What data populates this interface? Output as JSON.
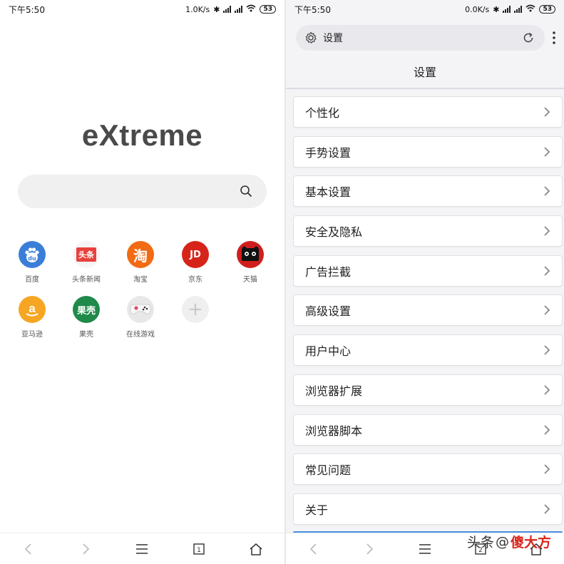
{
  "left": {
    "status": {
      "time": "下午5:50",
      "speed": "1.0K/s",
      "battery": "53"
    },
    "logo": "eXtreme",
    "shortcuts": [
      {
        "label": "百度",
        "icon": "baidu-icon",
        "glyph": "du",
        "color": "#3b7ed8"
      },
      {
        "label": "头条新闻",
        "icon": "toutiao-icon",
        "glyph": "头条",
        "color": "#e8413c"
      },
      {
        "label": "淘宝",
        "icon": "taobao-icon",
        "glyph": "淘",
        "color": "#f26a13"
      },
      {
        "label": "京东",
        "icon": "jd-icon",
        "glyph": "JD",
        "color": "#d7241b"
      },
      {
        "label": "天猫",
        "icon": "tmall-icon",
        "glyph": "",
        "color": "#d01e1e"
      },
      {
        "label": "亚马逊",
        "icon": "amazon-icon",
        "glyph": "a",
        "color": "#f6a623"
      },
      {
        "label": "果壳",
        "icon": "guokr-icon",
        "glyph": "果壳",
        "color": "#1f8a4a"
      },
      {
        "label": "在线游戏",
        "icon": "gamepad-icon",
        "glyph": "",
        "color": "#e8e8e8"
      },
      {
        "label": "",
        "icon": "add-icon",
        "glyph": "+",
        "color": "#efefef"
      }
    ]
  },
  "right": {
    "status": {
      "time": "下午5:50",
      "speed": "0.0K/s",
      "battery": "53"
    },
    "url": "设置",
    "title": "设置",
    "items": [
      {
        "label": "个性化"
      },
      {
        "label": "手势设置"
      },
      {
        "label": "基本设置"
      },
      {
        "label": "安全及隐私"
      },
      {
        "label": "广告拦截"
      },
      {
        "label": "高级设置"
      },
      {
        "label": "用户中心"
      },
      {
        "label": "浏览器扩展"
      },
      {
        "label": "浏览器脚本"
      },
      {
        "label": "常见问题"
      },
      {
        "label": "关于"
      }
    ],
    "tab_count": "2"
  },
  "left_tab_count": "1",
  "watermark": {
    "prefix": "头条",
    "at": "@",
    "brand": "傻大方"
  }
}
